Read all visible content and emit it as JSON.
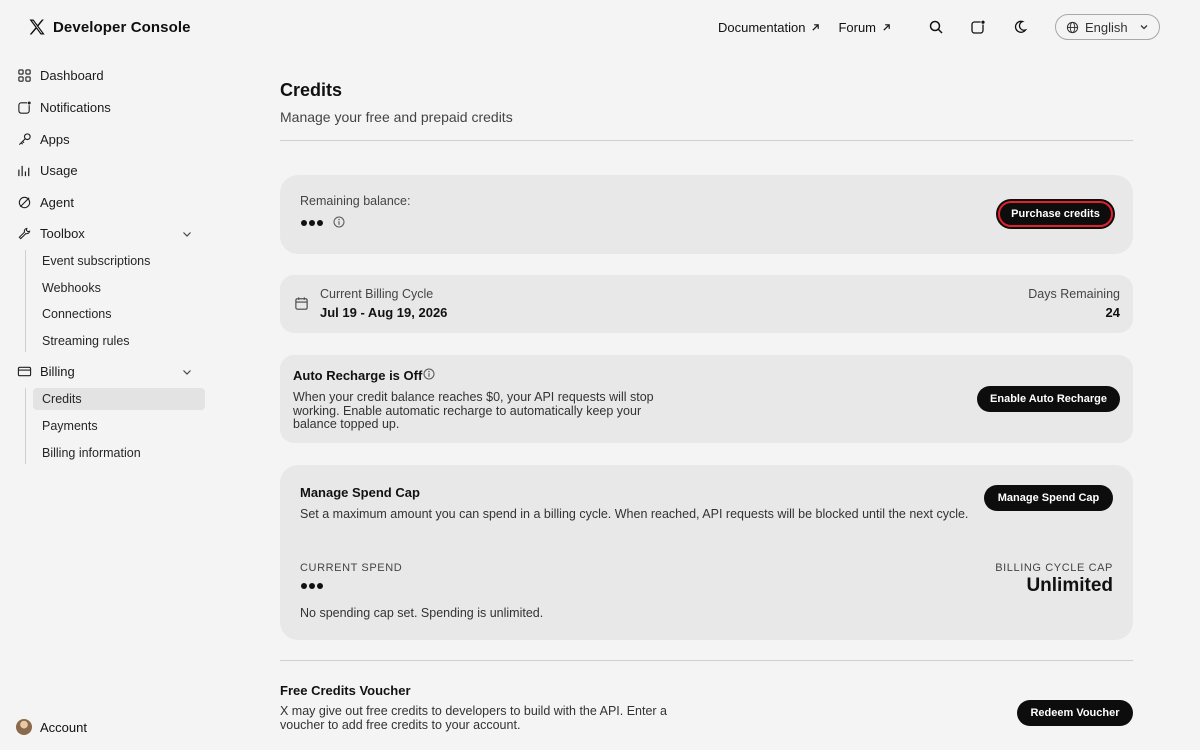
{
  "app": {
    "title": "Developer Console"
  },
  "topnav": {
    "documentation": "Documentation",
    "forum": "Forum",
    "language": "English"
  },
  "sidebar": {
    "dashboard": "Dashboard",
    "notifications": "Notifications",
    "apps": "Apps",
    "usage": "Usage",
    "agent": "Agent",
    "toolbox": {
      "label": "Toolbox",
      "items": [
        "Event subscriptions",
        "Webhooks",
        "Connections",
        "Streaming rules"
      ]
    },
    "billing": {
      "label": "Billing",
      "items": [
        "Credits",
        "Payments",
        "Billing information"
      ],
      "active": "Credits"
    },
    "account": "Account"
  },
  "page": {
    "title": "Credits",
    "subtitle": "Manage your free and prepaid credits"
  },
  "balance": {
    "label": "Remaining balance:",
    "button": "Purchase credits"
  },
  "billing_cycle": {
    "label": "Current Billing Cycle",
    "range": "Jul 19 - Aug 19, 2026",
    "days_label": "Days Remaining",
    "days_value": "24"
  },
  "auto_recharge": {
    "title": "Auto Recharge is Off",
    "body": "When your credit balance reaches $0, your API requests will stop working. Enable automatic recharge to automatically keep your balance topped up.",
    "button": "Enable Auto Recharge"
  },
  "spend_cap": {
    "title": "Manage Spend Cap",
    "body": "Set a maximum amount you can spend in a billing cycle. When reached, API requests will be blocked until the next cycle.",
    "button": "Manage Spend Cap",
    "current_spend_label": "CURRENT SPEND",
    "cap_label": "BILLING CYCLE CAP",
    "cap_value": "Unlimited",
    "note": "No spending cap set. Spending is unlimited."
  },
  "voucher": {
    "title": "Free Credits Voucher",
    "body": "X may give out free credits to developers to build with the API. Enter a voucher to add free credits to your account.",
    "button": "Redeem Voucher"
  },
  "colors": {
    "accent": "#0d0d0d",
    "highlight_ring": "#e0222a",
    "card": "#e8e8e8",
    "background": "#f4f4f4"
  }
}
